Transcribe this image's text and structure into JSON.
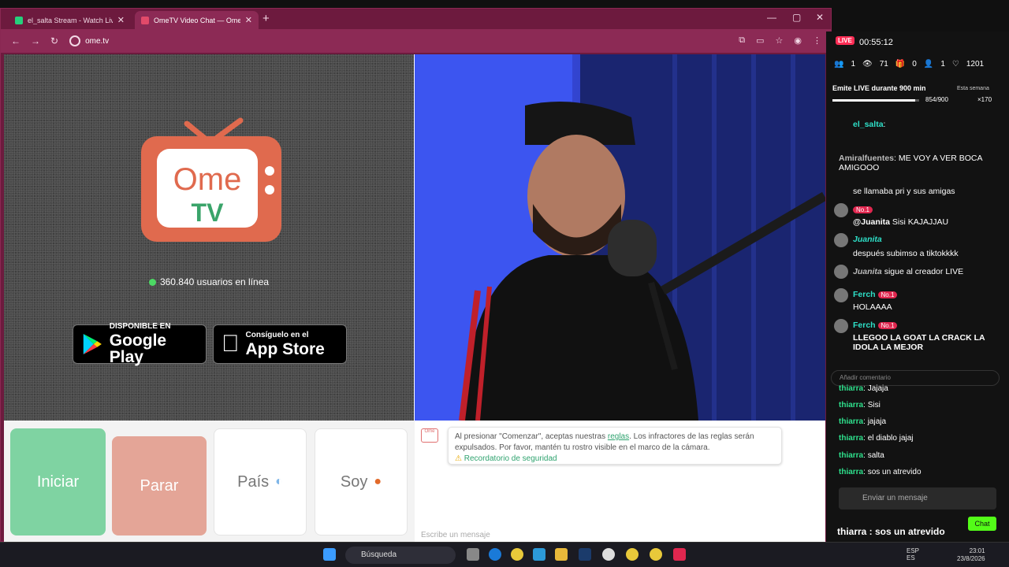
{
  "browser": {
    "tabs": [
      {
        "label": "el_salta Stream - Watch Live on",
        "color": "#26d07c"
      },
      {
        "label": "OmeTV Video Chat — Ome",
        "color": "#e24a6a"
      }
    ],
    "url": "ome.tv"
  },
  "ometv": {
    "logo_top": "Ome",
    "logo_bottom": "TV",
    "online_text": "360.840 usuarios en línea",
    "google_small": "DISPONIBLE EN",
    "google_big": "Google Play",
    "apple_small": "Consíguelo en el",
    "apple_big": "App Store",
    "buttons": {
      "start": "Iniciar",
      "stop": "Parar",
      "country": "País",
      "gender": "Soy"
    },
    "notice_text_1": "Al presionar \"Comenzar\", aceptas nuestras",
    "notice_link": "reglas",
    "notice_text_2": ". Los infractores de las reglas serán expulsados. Por favor, mantén tu rostro visible en el marco de la cámara.",
    "reminder": "Recordatorio de seguridad",
    "chat_placeholder": "Escribe un mensaje"
  },
  "tiktok": {
    "live_badge": "LIVE",
    "timer": "00:55:12",
    "stats": {
      "users": "1",
      "views": "71",
      "gifts": "0",
      "people": "1",
      "likes": "1201"
    },
    "goal": "Emite LIVE durante 900 min",
    "goal_progress": "854/900",
    "week": "Esta semana",
    "multiplier": "×170",
    "comments": [
      {
        "user": "el_salta",
        "text": ""
      },
      {
        "user": "Amiralfuentes",
        "text": "ME VOY A VER BOCA AMIGOOO"
      },
      {
        "user": "",
        "text": "se llamaba pri y sus amigas"
      },
      {
        "user": "@Juanita",
        "text": "Sisi KAJAJJAU"
      },
      {
        "user": "Juanita",
        "text": "después subimso a tiktokkkk"
      },
      {
        "user": "Juanita",
        "text": "sigue al creador LIVE"
      },
      {
        "user": "Ferch",
        "text": "HOLAAAA"
      },
      {
        "user": "Ferch",
        "text": "LLEGOO LA GOAT LA CRACK LA IDOLA LA MEJOR"
      }
    ],
    "add_comment": "Añadir comentario",
    "no1": "No.1"
  },
  "side_chat": {
    "messages": [
      {
        "user": "thiarra",
        "text": "Jajaja"
      },
      {
        "user": "thiarra",
        "text": "Sisi"
      },
      {
        "user": "thiarra",
        "text": "jajaja"
      },
      {
        "user": "thiarra",
        "text": "el diablo jajaj"
      },
      {
        "user": "thiarra",
        "text": "salta"
      },
      {
        "user": "thiarra",
        "text": "sos un atrevido"
      }
    ],
    "input_placeholder": "Enviar un mensaje",
    "chat_button": "Chat",
    "overlay": "thiarra : sos un atrevido"
  },
  "taskbar": {
    "search": "Búsqueda",
    "lang": "ESP",
    "lang2": "ES",
    "time": "23:01",
    "date": "23/8/2026"
  }
}
